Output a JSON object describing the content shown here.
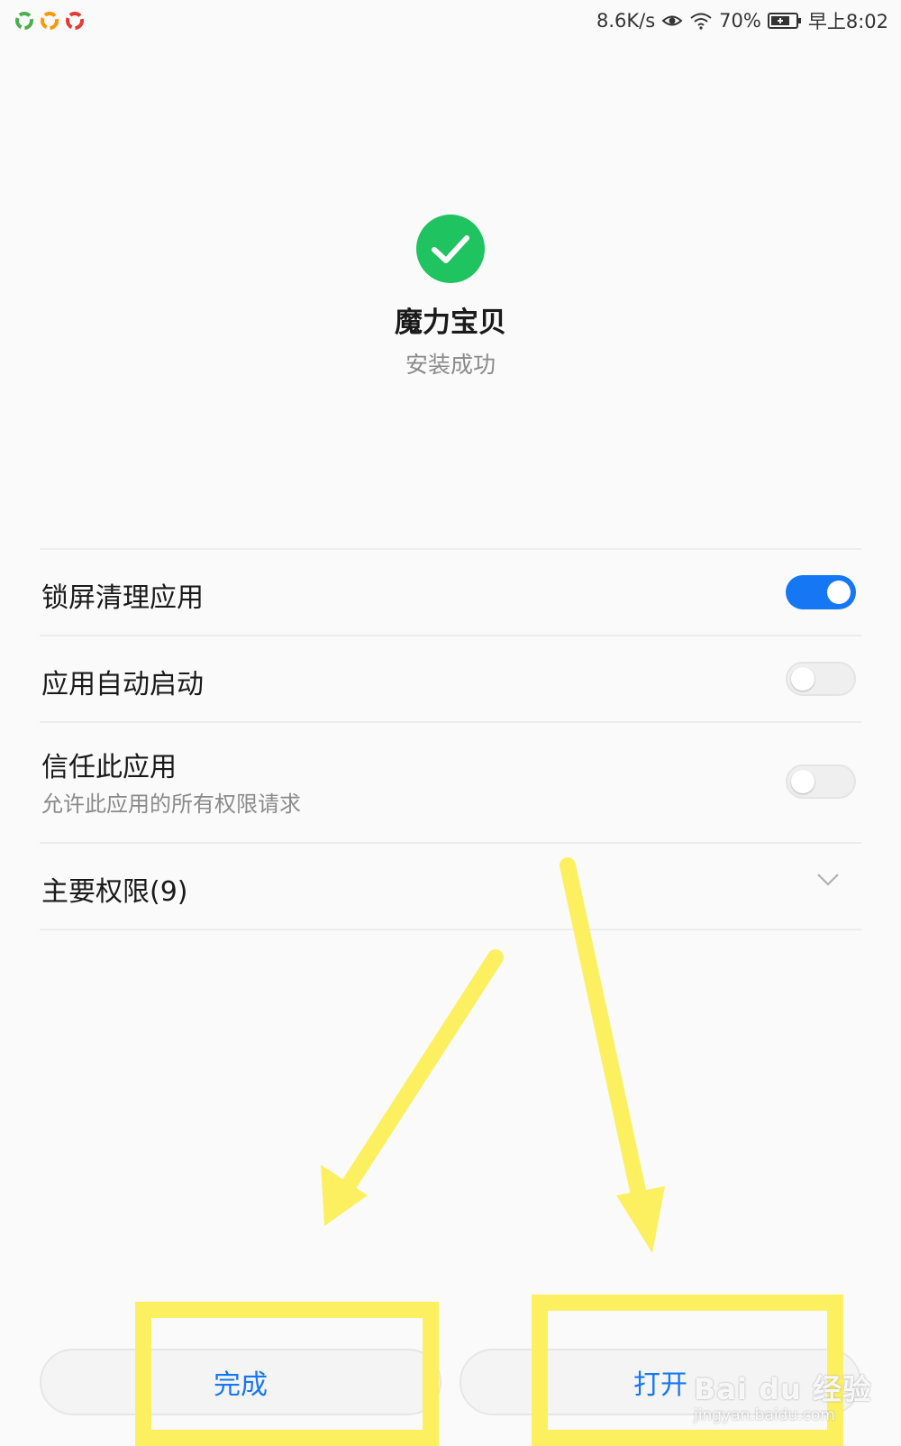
{
  "status_bar": {
    "net_speed": "8.6K/s",
    "battery_percent": "70%",
    "time": "早上8:02"
  },
  "install": {
    "app_name": "魔力宝贝",
    "status": "安装成功"
  },
  "settings": {
    "lock_clean": {
      "label": "锁屏清理应用",
      "enabled": true
    },
    "auto_start": {
      "label": "应用自动启动",
      "enabled": false
    },
    "trust_app": {
      "label": "信任此应用",
      "sublabel": "允许此应用的所有权限请求",
      "enabled": false
    },
    "permissions": {
      "label": "主要权限(9)"
    }
  },
  "buttons": {
    "done": "完成",
    "open": "打开"
  },
  "watermark": {
    "logo": "Bai du 经验",
    "url": "jingyan.baidu.com"
  },
  "colors": {
    "accent_blue": "#1677f5",
    "success_green": "#1fc35f",
    "annotation_yellow": "#fcf060"
  }
}
